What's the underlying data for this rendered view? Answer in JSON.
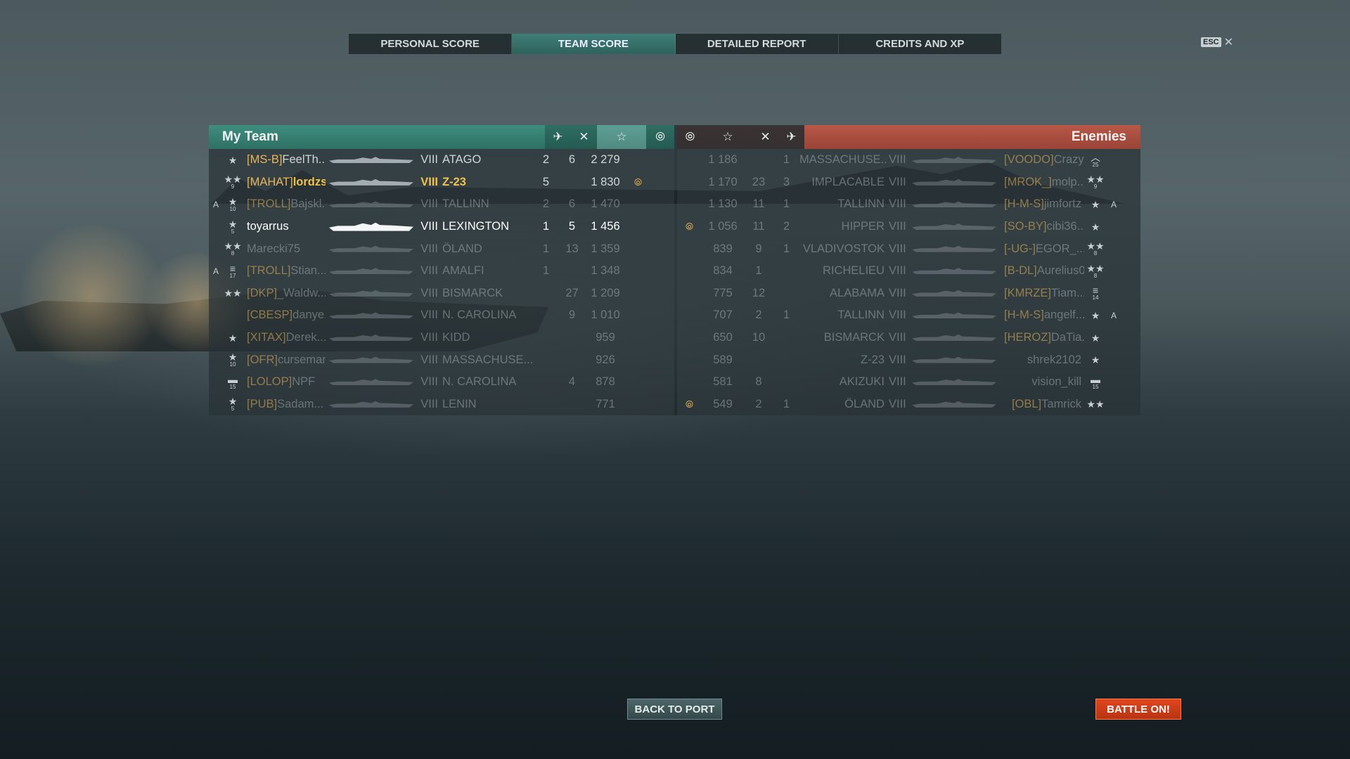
{
  "tabs": [
    {
      "label": "PERSONAL SCORE",
      "active": false
    },
    {
      "label": "TEAM SCORE",
      "active": true
    },
    {
      "label": "DETAILED REPORT",
      "active": false
    },
    {
      "label": "CREDITS AND XP",
      "active": false
    }
  ],
  "close": {
    "key_label": "ESC",
    "icon": "close-icon"
  },
  "teams": {
    "my_team_title": "My Team",
    "enemies_title": "Enemies",
    "header_icons": [
      "planes-destroyed-icon",
      "frags-icon",
      "base-xp-star-icon",
      "base-capture-icon"
    ]
  },
  "my_team": [
    {
      "badge": "",
      "rank_icon": "★",
      "rank_num": "",
      "clan": "[MS-B]",
      "name": "FeelTh...",
      "tier": "VIII",
      "ship": "ATAGO",
      "planes": "2",
      "frags": "6",
      "xp": "2 279",
      "cap": "",
      "dim": false,
      "self": false,
      "highlight": false
    },
    {
      "badge": "",
      "rank_icon": "★★",
      "rank_num": "9",
      "clan": "[MAHAT]",
      "name": "lordzs...",
      "tier": "VIII",
      "ship": "Z-23",
      "planes": "5",
      "frags": "",
      "xp": "1 830",
      "cap": "⦾",
      "dim": false,
      "self": false,
      "highlight": true
    },
    {
      "badge": "A",
      "rank_icon": "★",
      "rank_num": "10",
      "clan": "[TROLL]",
      "name": "Bajskl...",
      "tier": "VIII",
      "ship": "TALLINN",
      "planes": "2",
      "frags": "6",
      "xp": "1 470",
      "cap": "",
      "dim": true,
      "self": false,
      "highlight": false
    },
    {
      "badge": "",
      "rank_icon": "★",
      "rank_num": "5",
      "clan": "",
      "name": "toyarrus",
      "tier": "VIII",
      "ship": "LEXINGTON",
      "planes": "1",
      "frags": "5",
      "xp": "1 456",
      "cap": "",
      "dim": false,
      "self": true,
      "highlight": false
    },
    {
      "badge": "",
      "rank_icon": "★★",
      "rank_num": "8",
      "clan": "",
      "name": "Marecki75",
      "tier": "VIII",
      "ship": "ÖLAND",
      "planes": "1",
      "frags": "13",
      "xp": "1 359",
      "cap": "",
      "dim": true,
      "self": false,
      "highlight": false
    },
    {
      "badge": "A",
      "rank_icon": "≡",
      "rank_num": "17",
      "clan": "[TROLL]",
      "name": "Stian...",
      "tier": "VIII",
      "ship": "AMALFI",
      "planes": "1",
      "frags": "",
      "xp": "1 348",
      "cap": "",
      "dim": true,
      "self": false,
      "highlight": false
    },
    {
      "badge": "",
      "rank_icon": "★★",
      "rank_num": "",
      "clan": "[DKP]",
      "name": "_Waldw...",
      "tier": "VIII",
      "ship": "BISMARCK",
      "planes": "",
      "frags": "27",
      "xp": "1 209",
      "cap": "",
      "dim": true,
      "self": false,
      "highlight": false
    },
    {
      "badge": "",
      "rank_icon": "",
      "rank_num": "",
      "clan": "[CBESP]",
      "name": "danye...",
      "tier": "VIII",
      "ship": "N. CAROLINA",
      "planes": "",
      "frags": "9",
      "xp": "1 010",
      "cap": "",
      "dim": true,
      "self": false,
      "highlight": false
    },
    {
      "badge": "",
      "rank_icon": "★",
      "rank_num": "",
      "clan": "[XITAX]",
      "name": "Derek...",
      "tier": "VIII",
      "ship": "KIDD",
      "planes": "",
      "frags": "",
      "xp": "959",
      "cap": "",
      "dim": true,
      "self": false,
      "highlight": false
    },
    {
      "badge": "",
      "rank_icon": "★",
      "rank_num": "10",
      "clan": "[OFR]",
      "name": "curseman",
      "tier": "VIII",
      "ship": "MASSACHUSE...",
      "planes": "",
      "frags": "",
      "xp": "926",
      "cap": "",
      "dim": true,
      "self": false,
      "highlight": false
    },
    {
      "badge": "",
      "rank_icon": "▬",
      "rank_num": "15",
      "clan": "[LOLOP]",
      "name": "NPF",
      "tier": "VIII",
      "ship": "N. CAROLINA",
      "planes": "",
      "frags": "4",
      "xp": "878",
      "cap": "",
      "dim": true,
      "self": false,
      "highlight": false
    },
    {
      "badge": "",
      "rank_icon": "★",
      "rank_num": "5",
      "clan": "[PUB]",
      "name": "Sadam...",
      "tier": "VIII",
      "ship": "LENIN",
      "planes": "",
      "frags": "",
      "xp": "771",
      "cap": "",
      "dim": true,
      "self": false,
      "highlight": false
    }
  ],
  "enemies": [
    {
      "cap": "",
      "xp": "1 186",
      "frags": "",
      "planes": "1",
      "ship": "MASSACHUSE...",
      "tier": "VIII",
      "clan": "[VOODO]",
      "name": "Crazy...",
      "rank_icon": "︿",
      "rank_num": "25",
      "badge": "",
      "dim": true
    },
    {
      "cap": "",
      "xp": "1 170",
      "frags": "23",
      "planes": "3",
      "ship": "IMPLACABLE",
      "tier": "VIII",
      "clan": "[MROK_]",
      "name": "molp...",
      "rank_icon": "★★",
      "rank_num": "9",
      "badge": "",
      "dim": true
    },
    {
      "cap": "",
      "xp": "1 130",
      "frags": "11",
      "planes": "1",
      "ship": "TALLINN",
      "tier": "VIII",
      "clan": "[H-M-S]",
      "name": "jimfortz",
      "rank_icon": "★",
      "rank_num": "",
      "badge": "A",
      "dim": true
    },
    {
      "cap": "⦾",
      "xp": "1 056",
      "frags": "11",
      "planes": "2",
      "ship": "HIPPER",
      "tier": "VIII",
      "clan": "[SO-BY]",
      "name": "cibi36...",
      "rank_icon": "★",
      "rank_num": "",
      "badge": "",
      "dim": true
    },
    {
      "cap": "",
      "xp": "839",
      "frags": "9",
      "planes": "1",
      "ship": "VLADIVOSTOK",
      "tier": "VIII",
      "clan": "[-UG-]",
      "name": "EGOR_...",
      "rank_icon": "★★",
      "rank_num": "8",
      "badge": "",
      "dim": true
    },
    {
      "cap": "",
      "xp": "834",
      "frags": "1",
      "planes": "",
      "ship": "RICHELIEU",
      "tier": "VIII",
      "clan": "[B-DL]",
      "name": "Aurelius0...",
      "rank_icon": "★★",
      "rank_num": "8",
      "badge": "",
      "dim": true
    },
    {
      "cap": "",
      "xp": "775",
      "frags": "12",
      "planes": "",
      "ship": "ALABAMA",
      "tier": "VIII",
      "clan": "[KMRZE]",
      "name": "Tiam...",
      "rank_icon": "≡",
      "rank_num": "14",
      "badge": "",
      "dim": true
    },
    {
      "cap": "",
      "xp": "707",
      "frags": "2",
      "planes": "1",
      "ship": "TALLINN",
      "tier": "VIII",
      "clan": "[H-M-S]",
      "name": "angelf...",
      "rank_icon": "★",
      "rank_num": "",
      "badge": "A",
      "dim": true
    },
    {
      "cap": "",
      "xp": "650",
      "frags": "10",
      "planes": "",
      "ship": "BISMARCK",
      "tier": "VIII",
      "clan": "[HEROZ]",
      "name": "DaTia...",
      "rank_icon": "★",
      "rank_num": "",
      "badge": "",
      "dim": true
    },
    {
      "cap": "",
      "xp": "589",
      "frags": "",
      "planes": "",
      "ship": "Z-23",
      "tier": "VIII",
      "clan": "",
      "name": "shrek2102",
      "rank_icon": "★",
      "rank_num": "",
      "badge": "",
      "dim": true
    },
    {
      "cap": "",
      "xp": "581",
      "frags": "8",
      "planes": "",
      "ship": "AKIZUKI",
      "tier": "VIII",
      "clan": "",
      "name": "vision_kill",
      "rank_icon": "▬",
      "rank_num": "15",
      "badge": "",
      "dim": true
    },
    {
      "cap": "⦾",
      "xp": "549",
      "frags": "2",
      "planes": "1",
      "ship": "ÖLAND",
      "tier": "VIII",
      "clan": "[OBL]",
      "name": "Tamrick",
      "rank_icon": "★★",
      "rank_num": "",
      "badge": "",
      "dim": true
    }
  ],
  "buttons": {
    "back_to_port": "BACK TO PORT",
    "battle_on": "BATTLE ON!"
  },
  "colors": {
    "my_team_header": "#3e8e80",
    "enemies_header": "#b85848",
    "clan_tag": "#e8b55a",
    "highlight": "#f2c14a",
    "battle_button": "#e0461e"
  }
}
